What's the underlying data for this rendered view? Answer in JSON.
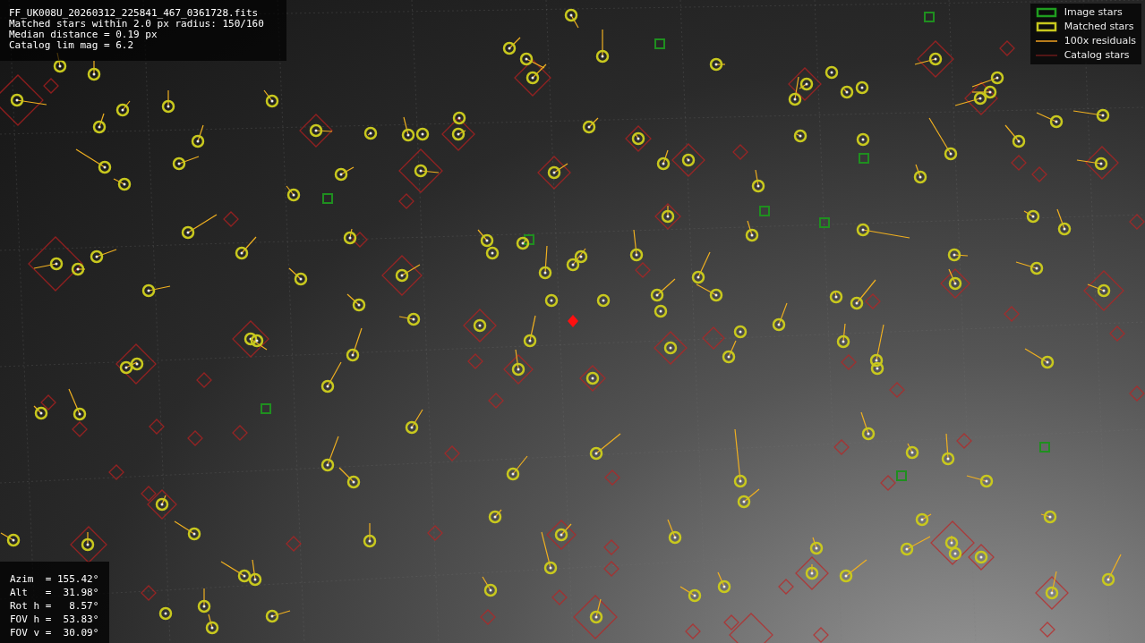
{
  "header": {
    "lines": [
      "FF_UK008U_20260312_225841_467_0361728.fits",
      "Matched stars within 2.0 px radius: 150/160",
      "Median distance = 0.19 px",
      "Catalog lim mag = 6.2"
    ]
  },
  "legend": {
    "items": [
      {
        "label": "Image stars",
        "kind": "image"
      },
      {
        "label": "Matched stars",
        "kind": "matched"
      },
      {
        "label": "100x residuals",
        "kind": "residual"
      },
      {
        "label": "Catalog stars",
        "kind": "catalog"
      }
    ]
  },
  "pointing": {
    "lines": [
      "Azim  = 155.42°",
      "Alt   =  31.98°",
      "Rot h =   8.57°",
      "FOV h =  53.83°",
      "FOV v =  30.09°"
    ]
  }
}
